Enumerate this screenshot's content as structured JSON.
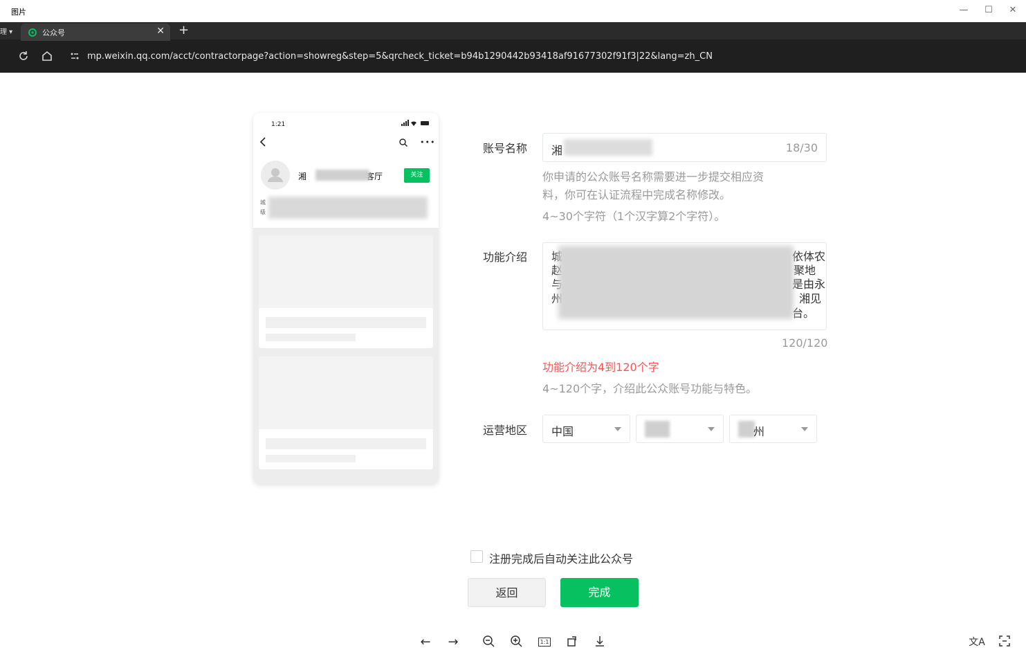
{
  "viewer": {
    "title": "图片",
    "window_controls": [
      "minimize",
      "maximize",
      "close"
    ],
    "toolbar": [
      "arrow-left-icon",
      "arrow-right-icon",
      "zoom-out-icon",
      "zoom-in-icon",
      "actual-size-icon",
      "rotate-icon",
      "download-icon",
      "translate-icon",
      "text-extract-icon"
    ],
    "actual_size_label": "1:1"
  },
  "browser": {
    "prev_tab_label": "理",
    "tab": {
      "title": "公众号",
      "close": "✕"
    },
    "new_tab": "+",
    "url": "mp.weixin.qq.com/acct/contractorpage?action=showreg&step=5&qrcheck_ticket=b94b1290442b93418af91677302f91f3|22&lang=zh_CN"
  },
  "preview": {
    "time": "1:21",
    "account_name_start": "湘",
    "account_name_end": "客厅",
    "follow_label": "关注",
    "desc_line1_start": "城",
    "desc_line2_start": "级"
  },
  "form": {
    "name": {
      "label": "账号名称",
      "value_start": "湘",
      "count": "18/30",
      "hint1": "你申请的公众账号名称需要进一步提交相应资",
      "hint2": "料，你可在认证流程中完成名称修改。",
      "hint3": "4~30个字符（1个汉字算2个字符）。"
    },
    "intro": {
      "label": "功能介绍",
      "lines_start": [
        "城",
        "赵",
        "与",
        "州"
      ],
      "lines_end": [
        "依体农",
        "聚地",
        "是由永",
        "湘见",
        "台。"
      ],
      "count": "120/120",
      "error": "功能介绍为4到120个字",
      "hint": "4~120个字，介绍此公众账号功能与特色。"
    },
    "region": {
      "label": "运营地区",
      "country": "中国",
      "city_end": "州"
    },
    "auto_follow_label": "注册完成后自动关注此公众号",
    "back_label": "返回",
    "done_label": "完成"
  },
  "colors": {
    "accent": "#07c160",
    "error": "#fa5151",
    "hint": "#9a9a9a",
    "chrome": "#1f1f1f"
  }
}
